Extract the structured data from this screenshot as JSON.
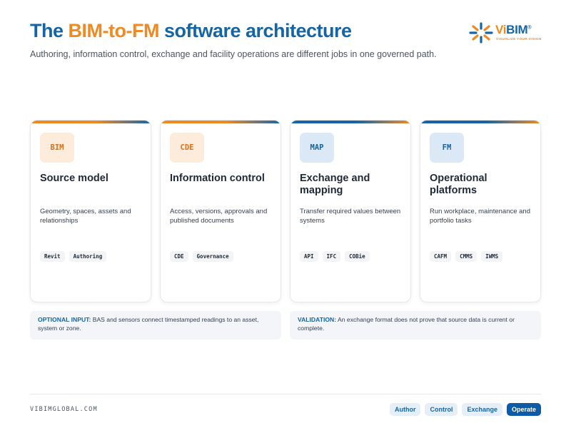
{
  "header": {
    "title_prefix": "The ",
    "title_accent": "BIM-to-FM",
    "title_suffix": " software architecture",
    "subtitle": "Authoring, information control, exchange and facility operations are different jobs in one governed path."
  },
  "logo": {
    "vi": "Vi",
    "bim": "BIM",
    "reg": "®",
    "tagline": "VISUALIZE YOUR VISION"
  },
  "cards": [
    {
      "badge": "BIM",
      "title": "Source model",
      "description": "Geometry, spaces, assets and relationships",
      "tags": [
        "Revit",
        "Authoring"
      ]
    },
    {
      "badge": "CDE",
      "title": "Information control",
      "description": "Access, versions, approvals and published documents",
      "tags": [
        "CDE",
        "Governance"
      ]
    },
    {
      "badge": "MAP",
      "title": "Exchange and mapping",
      "description": "Transfer required values between systems",
      "tags": [
        "API",
        "IFC",
        "COBie"
      ]
    },
    {
      "badge": "FM",
      "title": "Operational platforms",
      "description": "Run workplace, maintenance and portfolio tasks",
      "tags": [
        "CAFM",
        "CMMS",
        "IWMS"
      ]
    }
  ],
  "notes": {
    "optional_label": "OPTIONAL INPUT:",
    "optional_text": " BAS and sensors connect timestamped readings to an asset, system or zone.",
    "validation_label": "VALIDATION:",
    "validation_text": " An exchange format does not prove that source data is current or complete."
  },
  "footer": {
    "site": "VIBIMGLOBAL.COM",
    "nav": [
      "Author",
      "Control",
      "Exchange",
      "Operate"
    ],
    "active": "Operate"
  },
  "colors": {
    "brand_blue": "#1565a6",
    "brand_orange": "#ef8a23"
  }
}
